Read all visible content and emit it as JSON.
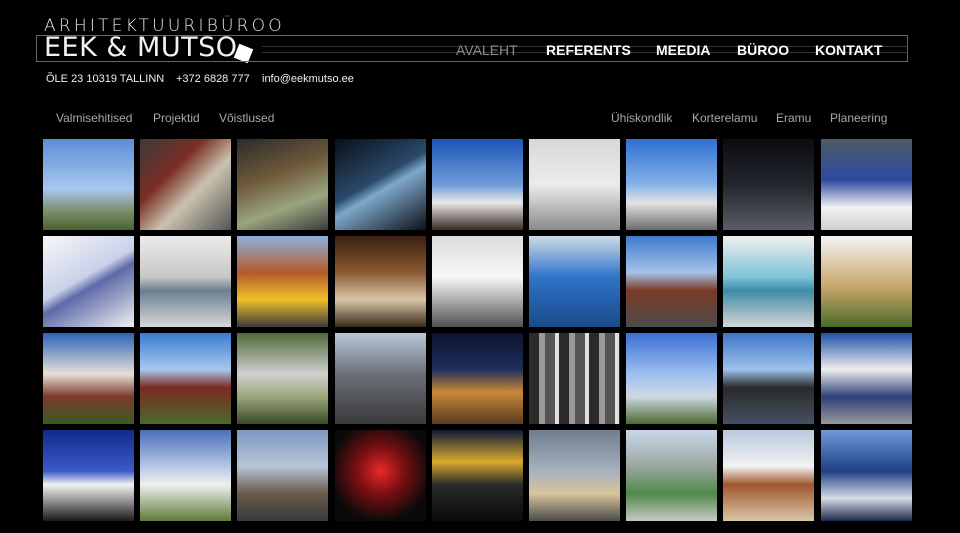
{
  "brand": {
    "tagline": "ARHITEKTUURIBÜROO",
    "name": "EEK & MUTSO"
  },
  "contact": {
    "address": "ÕLE 23 10319 TALLINN",
    "phone": "+372 6828 777",
    "email": "info@eekmutso.ee"
  },
  "nav": [
    {
      "label": "AVALEHT",
      "active": true
    },
    {
      "label": "REFERENTS",
      "active": false
    },
    {
      "label": "MEEDIA",
      "active": false
    },
    {
      "label": "BÜROO",
      "active": false
    },
    {
      "label": "KONTAKT",
      "active": false
    }
  ],
  "filters_left": [
    "Valmisehitised",
    "Projektid",
    "Võistlused"
  ],
  "filters_right": [
    "Ühiskondlik",
    "Korterelamu",
    "Eramu",
    "Planeering"
  ],
  "colors": {
    "background": "#000000",
    "nav_active": "#8b8b8b",
    "filter_text": "#a8a8a8"
  },
  "thumbnails": [
    "sky-cone-building",
    "red-block-model",
    "site-model-aerial",
    "dark-interior",
    "zigzag-roof-building",
    "interior-model-figures",
    "glass-facade-blue-sky",
    "night-model-aerial",
    "blue-glass-pavilion",
    "white-block-model",
    "striped-facade-render",
    "orange-apartment-block",
    "wooden-interior",
    "white-house-driveway",
    "glass-tower",
    "brick-apartment-row",
    "stadium-model",
    "glass-pavilion-trees",
    "apartment-block-trees",
    "red-rowhouses",
    "white-block-trees",
    "grey-city-street",
    "dusk-house",
    "mosaic-facade",
    "angular-white-building",
    "shopping-glass-front",
    "white-balcony-block",
    "blue-dusk-canopy",
    "white-villa-sky",
    "metal-facade-stairs",
    "red-neon-night",
    "gas-station-canopy",
    "canopy-grey-sky",
    "green-glass-office",
    "beach-pavilion",
    "blue-angular-tower"
  ]
}
